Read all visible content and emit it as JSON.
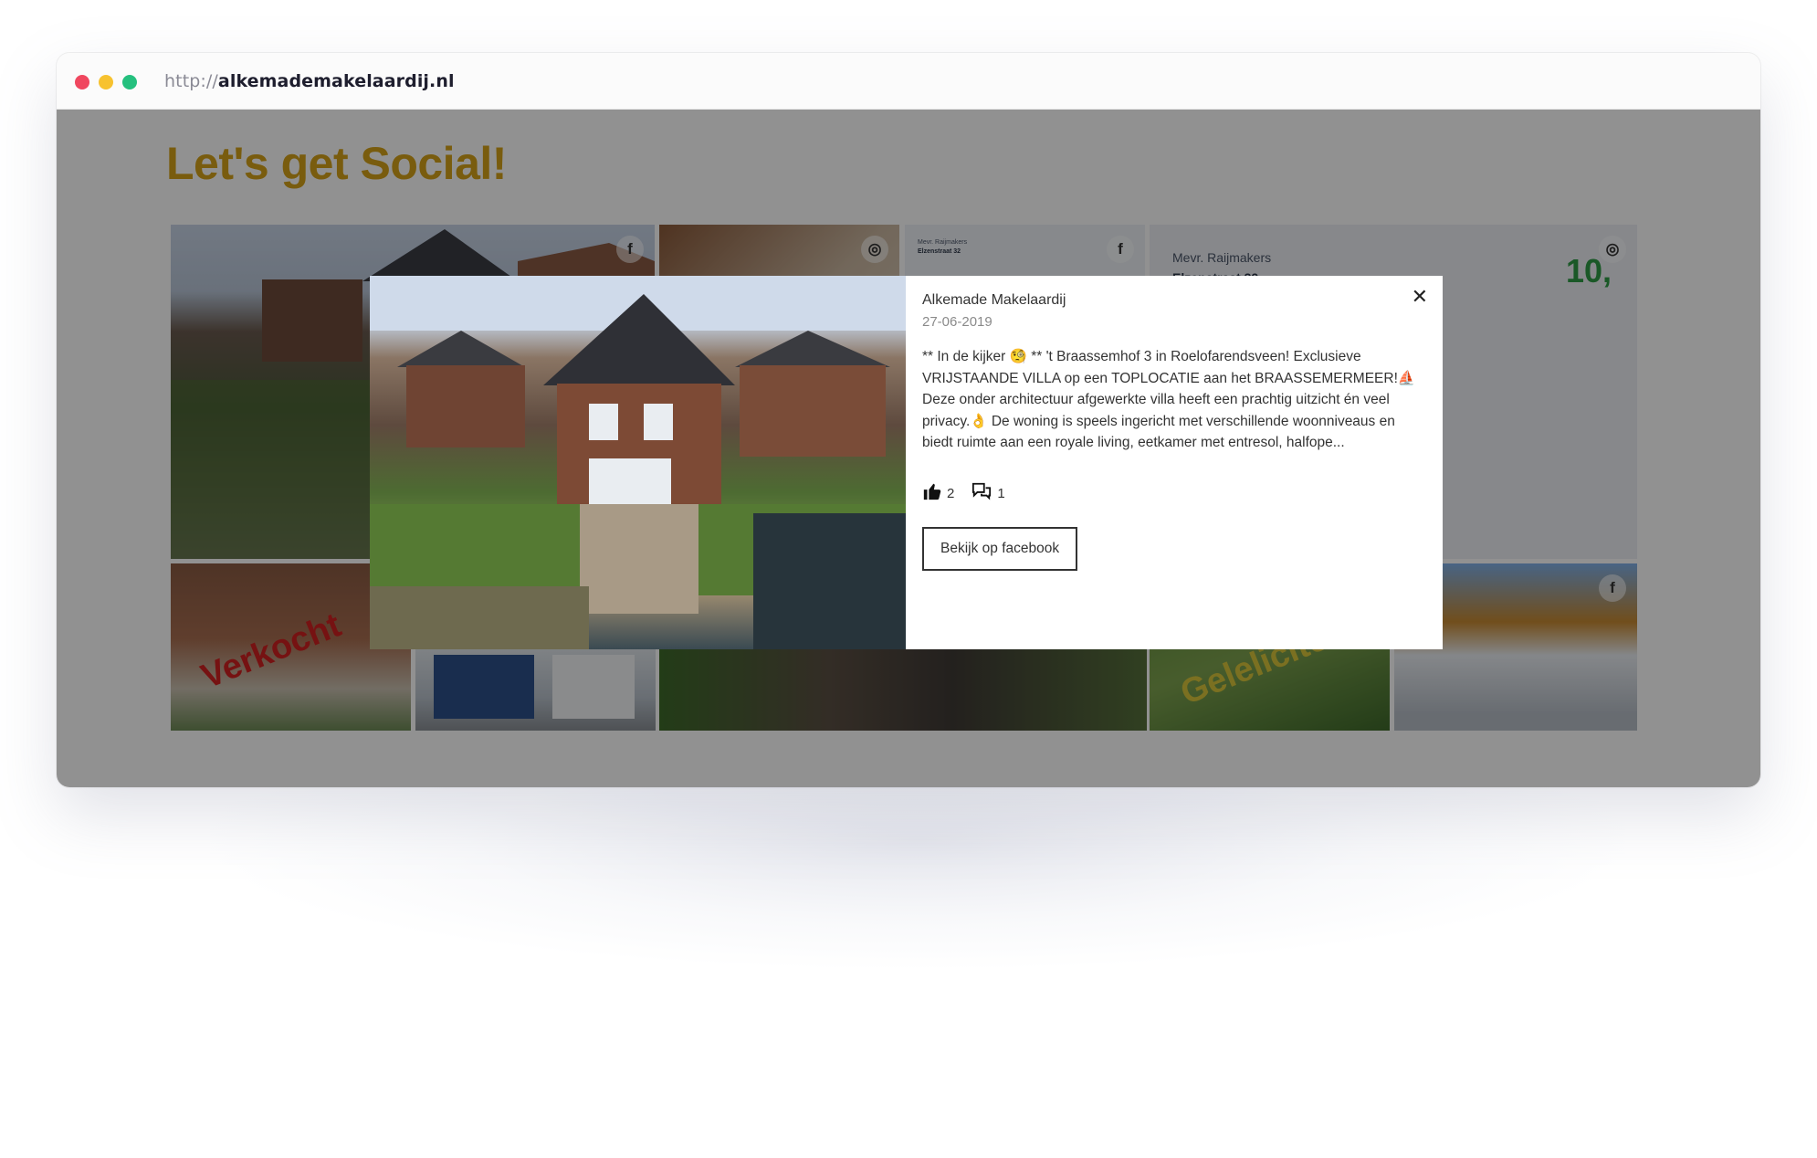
{
  "browser": {
    "url_protocol": "http://",
    "url_host": "alkemademakelaardij.nl"
  },
  "page": {
    "heading": "Let's get Social!",
    "tiles": {
      "facebook_badge": "f",
      "instagram_badge": "◎",
      "sold_stamp": "Verkocht",
      "rented_stamp": "Geleliciteerd",
      "review_name": "Mevr. Raijmakers",
      "review_street": "Elzenstraat 32",
      "review_score": "10,"
    }
  },
  "modal": {
    "author": "Alkemade Makelaardij",
    "date": "27-06-2019",
    "text": "** In de kijker 🧐 ** 't Braassemhof 3 in Roelofarendsveen! Exclusieve VRIJSTAANDE VILLA op een TOPLOCATIE aan het BRAASSEMERMEER!⛵ Deze onder architectuur afgewerkte villa heeft een prachtig uitzicht én veel privacy.👌 De woning is speels ingericht met verschillende woonniveaus en biedt ruimte aan een royale living, eetkamer met entresol, halfope...",
    "likes": "2",
    "comments": "1",
    "button_label": "Bekijk op facebook",
    "close_glyph": "✕"
  },
  "colors": {
    "heading": "#d5a21a",
    "overlay": "rgba(0,0,0,0.43)",
    "dot_red": "#f0475f",
    "dot_yellow": "#f7c22f",
    "dot_green": "#25c07e"
  }
}
